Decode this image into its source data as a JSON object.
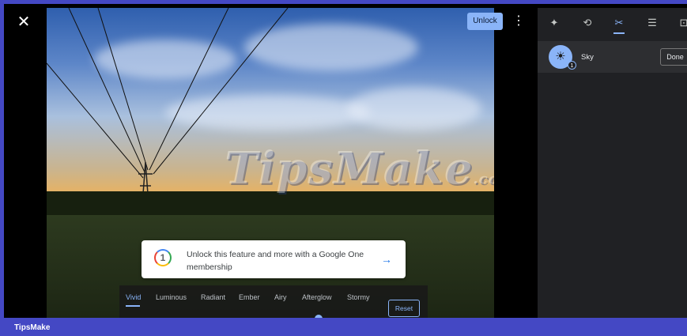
{
  "viewer": {
    "close_icon": "close-icon",
    "unlock_label": "Unlock",
    "more_icon": "more-vert-icon"
  },
  "photo": {
    "watermark_text": "TipsMake",
    "watermark_suffix": ".com"
  },
  "promo": {
    "icon": "google-one-icon",
    "icon_glyph": "1",
    "text": "Unlock this feature and more with a Google One membership",
    "arrow_icon": "arrow-right-icon"
  },
  "styles": {
    "items": [
      "Vivid",
      "Luminous",
      "Radiant",
      "Ember",
      "Airy",
      "Afterglow",
      "Stormy"
    ],
    "active": "Vivid",
    "reset_label": "Reset",
    "intensity": 0.8
  },
  "panel": {
    "tabs": [
      {
        "icon": "sparkle-icon",
        "glyph": "✦"
      },
      {
        "icon": "crop-rotate-icon",
        "glyph": "⟲"
      },
      {
        "icon": "tools-icon",
        "glyph": "✂"
      },
      {
        "icon": "adjust-icon",
        "glyph": "☰"
      },
      {
        "icon": "export-icon",
        "glyph": "⊡"
      }
    ],
    "active_tab": 2,
    "sky": {
      "icon": "sky-sun-icon",
      "glyph": "☀",
      "badge": "1",
      "label": "Sky",
      "done_label": "Done"
    }
  },
  "footer": {
    "label": "TipsMake"
  },
  "colors": {
    "accent": "#8ab4f8",
    "frame_border": "#4448c4",
    "panel_bg": "#202124"
  }
}
